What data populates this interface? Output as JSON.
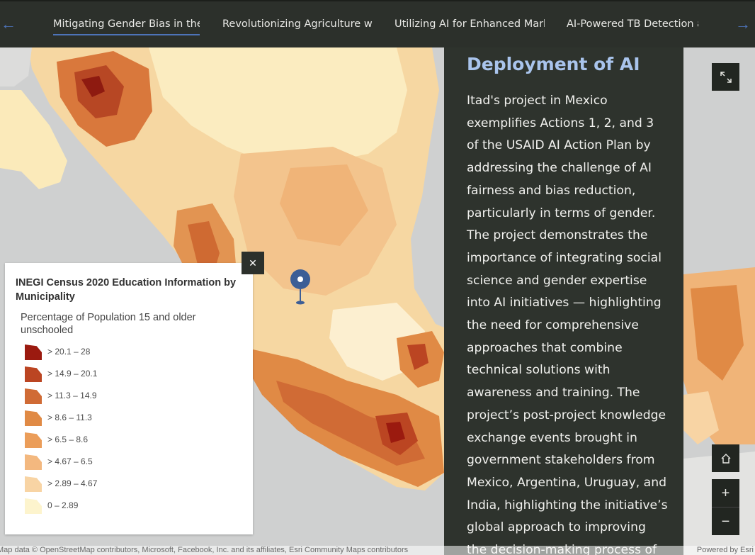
{
  "nav": {
    "prev_icon": "arrow-left-icon",
    "next_icon": "arrow-right-icon",
    "tabs": [
      {
        "label": "Mitigating Gender Bias in the ...",
        "active": true
      },
      {
        "label": "Revolutionizing Agriculture wi..."
      },
      {
        "label": "Utilizing AI for Enhanced Mark..."
      },
      {
        "label": "AI-Powered TB Detection an"
      }
    ]
  },
  "panel": {
    "heading": "Deployment of AI",
    "body": "Itad's project in Mexico exemplifies Actions 1,  2, and 3 of the USAID AI Action Plan by addressing the challenge of AI fairness and bias reduction, particularly in terms of gender. The project demonstrates the importance of integrating social science and gender expertise into AI initiatives — highlighting the need for comprehensive approaches that combine technical solutions with awareness and training. The project’s post-project knowledge exchange events  brought in government stakeholders from Mexico, Argentina, Uruguay, and India, highlighting the initiative’s global approach to improving the decision-making process of"
  },
  "legend": {
    "title": "INEGI Census 2020 Education Information by Municipality",
    "field": "Percentage of Population 15 and older unschooled",
    "classes": [
      {
        "label": "> 20.1 – 28",
        "color": "#9b1a0f"
      },
      {
        "label": "> 14.9 – 20.1",
        "color": "#bb4522"
      },
      {
        "label": "> 11.3 – 14.9",
        "color": "#d06b35"
      },
      {
        "label": "> 8.6 – 11.3",
        "color": "#e08a45"
      },
      {
        "label": "> 6.5 – 8.6",
        "color": "#eb9d59"
      },
      {
        "label": "> 4.67 – 6.5",
        "color": "#f3b87f"
      },
      {
        "label": "> 2.89 – 4.67",
        "color": "#f8d4a4"
      },
      {
        "label": "0 – 2.89",
        "color": "#fdf4cd"
      }
    ],
    "close_icon": "close-icon"
  },
  "widgets": {
    "expand_icon": "expand-icon",
    "home_icon": "home-icon",
    "zoom_in": "+",
    "zoom_out": "−"
  },
  "attribution": {
    "sources": "Map data © OpenStreetMap contributors, Microsoft, Facebook, Inc. and its affiliates, Esri Community Maps contributors",
    "powered_by": "Powered by Esri"
  },
  "colors": {
    "nav_background": "#2c302b",
    "accent": "#4d73b8",
    "heading": "#a9c4ec",
    "water": "#cfd0d0"
  }
}
